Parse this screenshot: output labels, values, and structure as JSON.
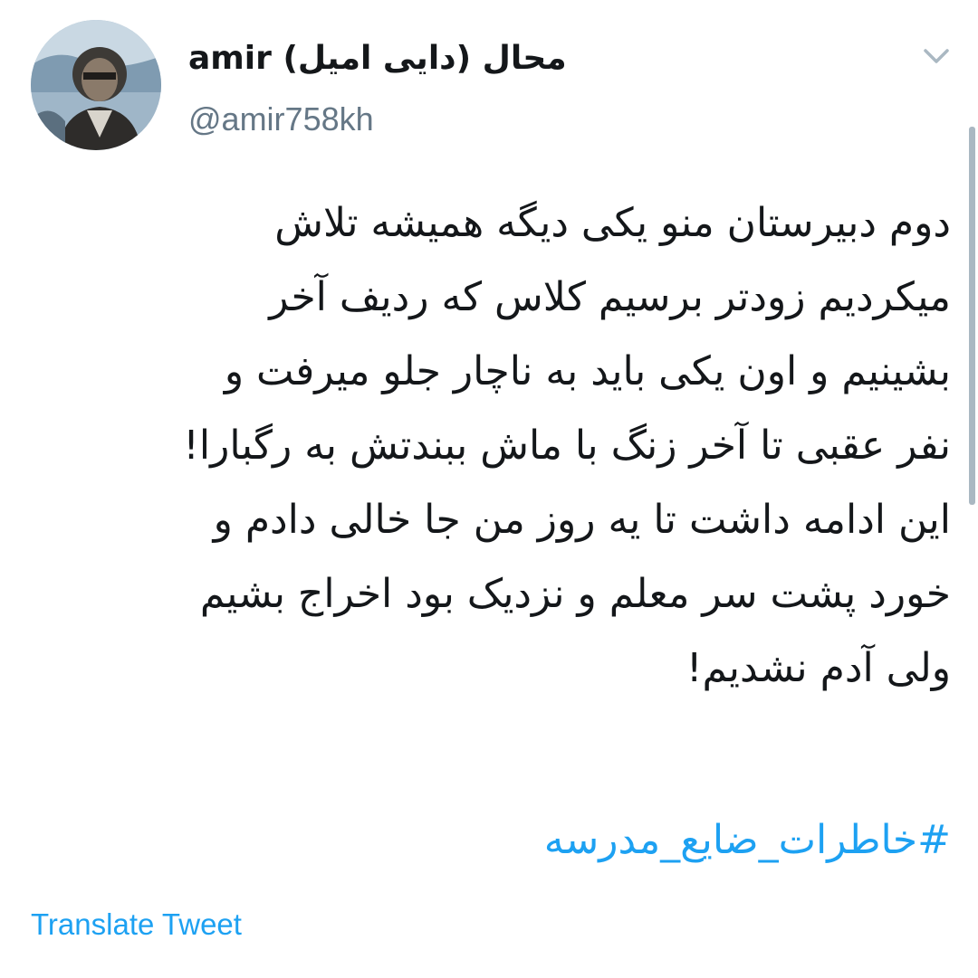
{
  "tweet": {
    "author": {
      "display_name": "محال (دایی امیل) amir",
      "handle": "@amir758kh",
      "avatar_icon": "avatar-photo"
    },
    "menu_icon": "chevron-down-icon",
    "text_lines": [
      "دوم دبیرستان منو یکی دیگه همیشه تلاش",
      "میکردیم زودتر برسیم کلاس که ردیف آخر",
      "بشینیم و اون یکی باید به ناچار جلو میرفت و",
      "نفر عقبی تا آخر زنگ با ماش ببندتش به رگبارا!",
      "این ادامه داشت تا یه روز من جا خالی دادم و",
      "خورد پشت سر معلم و نزدیک بود اخراج بشیم",
      "ولی آدم نشدیم!"
    ],
    "hashtag": "#خاطرات_ضایع_مدرسه",
    "translate_label": "Translate Tweet"
  },
  "colors": {
    "text": "#14171a",
    "secondary_text": "#657786",
    "link": "#1da1f2",
    "scrollbar": "#aab8c2",
    "background": "#ffffff"
  }
}
